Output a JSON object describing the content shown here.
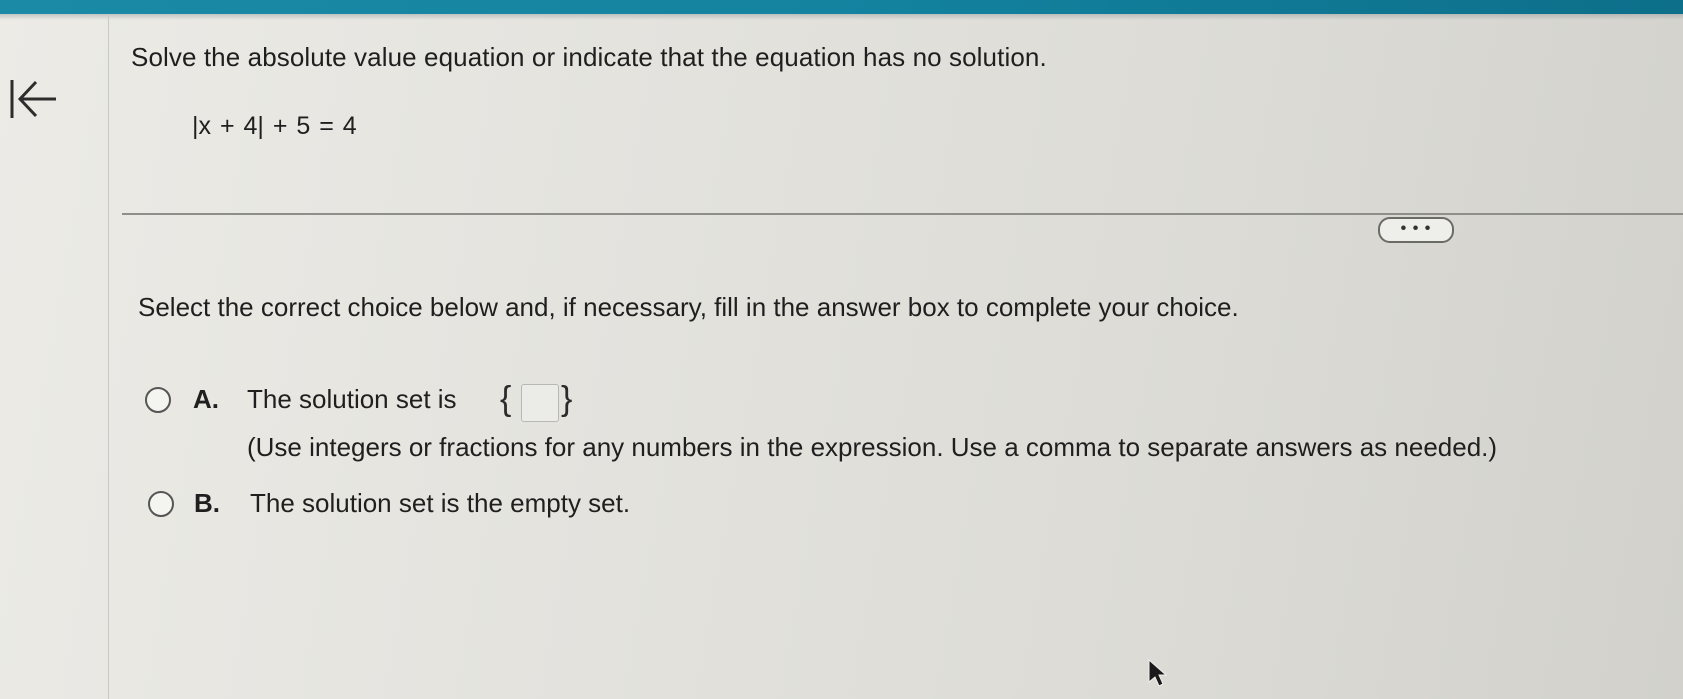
{
  "header": {
    "accent_color": "#1383a0"
  },
  "navigation": {
    "back_icon": "arrow-left-to-bar-icon"
  },
  "problem": {
    "question": "Solve the absolute value equation or indicate that the equation has no solution.",
    "equation": "|x + 4| + 5 = 4"
  },
  "toolbar": {
    "more_label": "• • •"
  },
  "answer": {
    "instruction": "Select the correct choice below and, if necessary, fill in the answer box to complete your choice.",
    "choices": [
      {
        "letter": "A.",
        "text": "The solution set is",
        "answer_value": "",
        "hint": "(Use integers or fractions for any numbers in the expression. Use a comma to separate answers as needed.)"
      },
      {
        "letter": "B.",
        "text": "The solution set is the empty set."
      }
    ],
    "brace_left": "{",
    "brace_right": "}"
  }
}
